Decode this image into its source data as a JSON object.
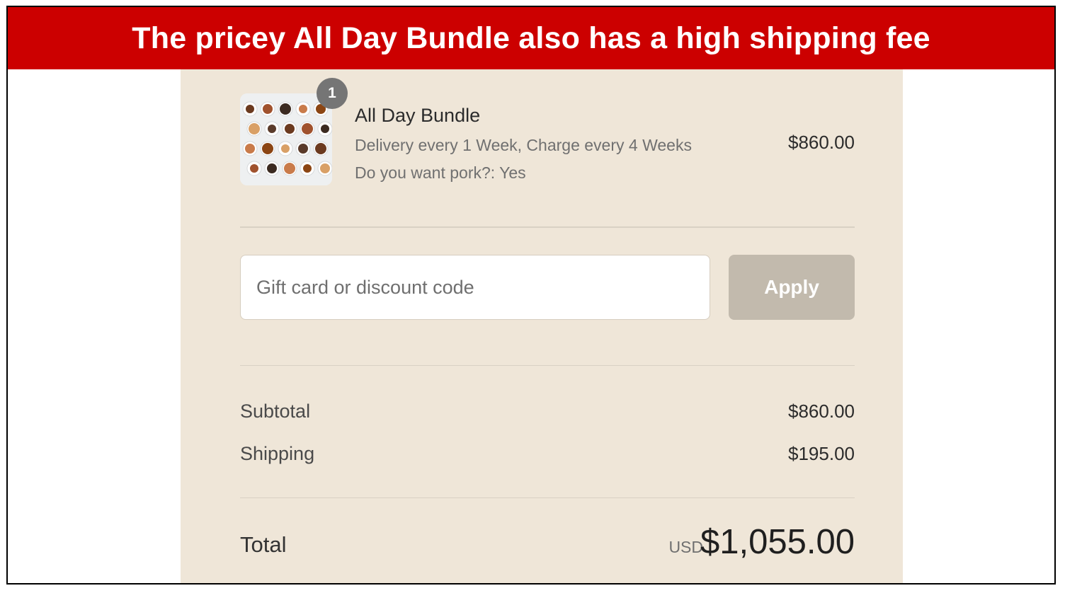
{
  "banner": {
    "title": "The pricey All Day Bundle also has a high shipping fee"
  },
  "item": {
    "quantity_badge": "1",
    "name": "All Day Bundle",
    "delivery": "Delivery every 1 Week, Charge every 4 Weeks",
    "option": "Do you want pork?: Yes",
    "price": "$860.00"
  },
  "discount": {
    "placeholder": "Gift card or discount code",
    "apply_label": "Apply"
  },
  "summary": {
    "subtotal_label": "Subtotal",
    "subtotal_value": "$860.00",
    "shipping_label": "Shipping",
    "shipping_value": "$195.00",
    "total_label": "Total",
    "currency": "USD",
    "total_value": "$1,055.00"
  },
  "colors": {
    "banner": "#cc0000",
    "panel": "#efe6d8",
    "apply_button": "#c2baad",
    "badge": "#757575"
  }
}
